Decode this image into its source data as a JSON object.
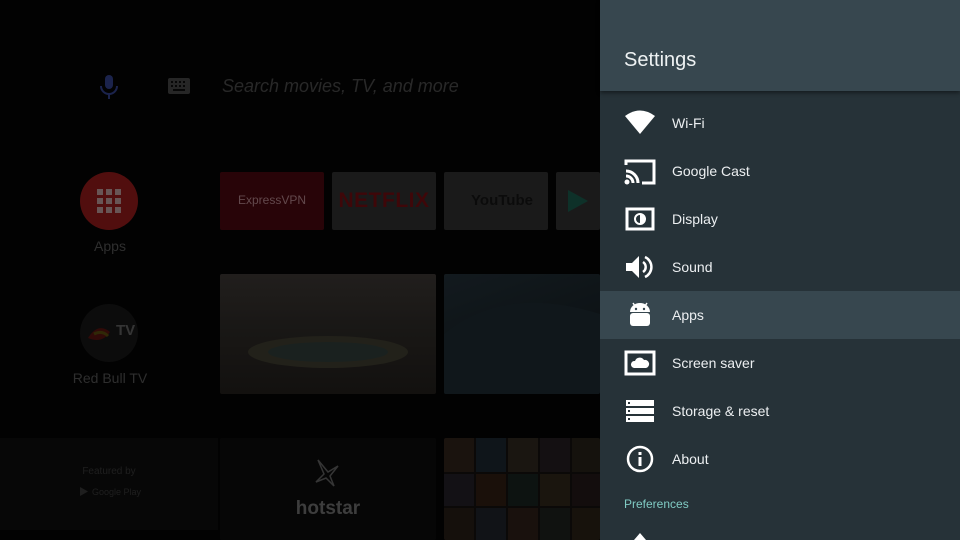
{
  "launcher": {
    "search": {
      "placeholder": "Search movies, TV, and more"
    },
    "rows": [
      {
        "label": "Apps",
        "icon": "apps-grid-icon"
      },
      {
        "label": "Red Bull TV",
        "icon": "red-bull-tv-icon"
      }
    ],
    "app_tiles": [
      {
        "label": "ExpressVPN",
        "color": "#c8102e"
      },
      {
        "label": "NETFLIX",
        "color": "#e50914"
      },
      {
        "label": "YouTube",
        "color": "#ff0000"
      }
    ],
    "featured": {
      "label": "Featured by",
      "sub": "Google Play"
    },
    "hotstar_label": "hotstar",
    "redbull_badge": "TV"
  },
  "settings": {
    "title": "Settings",
    "items": [
      {
        "label": "Wi-Fi",
        "icon": "wifi-icon"
      },
      {
        "label": "Google Cast",
        "icon": "cast-icon"
      },
      {
        "label": "Display",
        "icon": "display-icon"
      },
      {
        "label": "Sound",
        "icon": "volume-icon"
      },
      {
        "label": "Apps",
        "icon": "android-icon",
        "selected": true
      },
      {
        "label": "Screen saver",
        "icon": "screen-saver-icon"
      },
      {
        "label": "Storage & reset",
        "icon": "storage-icon"
      },
      {
        "label": "About",
        "icon": "info-icon"
      }
    ],
    "section": "Preferences"
  },
  "colors": {
    "panel_bg": "#263238",
    "panel_header": "#37474f",
    "selected_row": "#37474f",
    "section_accent": "#80cbc4",
    "apps_accent": "#b3201f"
  }
}
